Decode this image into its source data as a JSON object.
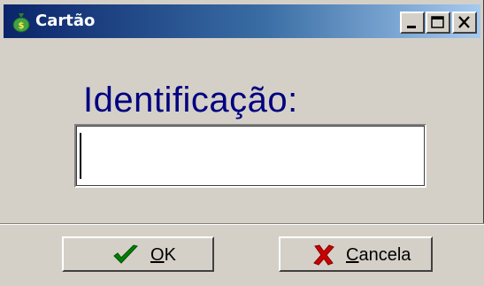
{
  "window": {
    "title": "Cartão",
    "icon": "money-bag-icon"
  },
  "titlebar_buttons": {
    "minimize": "minimize-icon",
    "maximize": "maximize-icon",
    "close": "close-icon"
  },
  "form": {
    "label": "Identificação:",
    "input_value": "",
    "input_placeholder": ""
  },
  "buttons": {
    "ok": {
      "mnemonic": "O",
      "rest": "K",
      "icon": "checkmark-icon"
    },
    "cancel": {
      "mnemonic": "C",
      "rest": "ancela",
      "icon": "x-mark-icon"
    }
  },
  "colors": {
    "title_bg_start": "#0a246a",
    "title_bg_end": "#a6caf0",
    "label_color": "#000080",
    "ok_icon": "#008000",
    "cancel_icon": "#cc0000"
  }
}
